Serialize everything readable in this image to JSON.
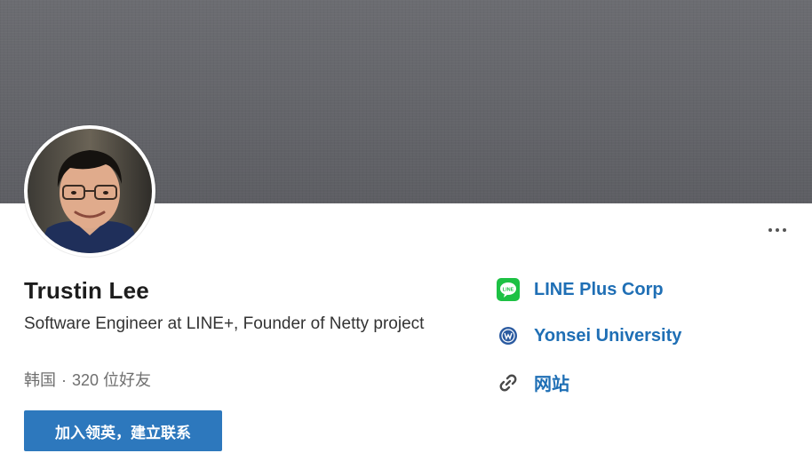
{
  "profile": {
    "name": "Trustin Lee",
    "headline": "Software Engineer at LINE+, Founder of Netty project",
    "location": "韩国",
    "separator": "·",
    "connections": "320 位好友"
  },
  "actions": {
    "connect_label": "加入领英，建立联系"
  },
  "sidebar": {
    "items": [
      {
        "label": "LINE Plus Corp",
        "icon": "line-logo-icon"
      },
      {
        "label": "Yonsei University",
        "icon": "university-seal-icon"
      },
      {
        "label": "网站",
        "icon": "link-icon"
      }
    ]
  },
  "colors": {
    "banner": "#636469",
    "accent": "#2d78bd",
    "link": "#1f6fb5",
    "line_green": "#1dc144"
  }
}
